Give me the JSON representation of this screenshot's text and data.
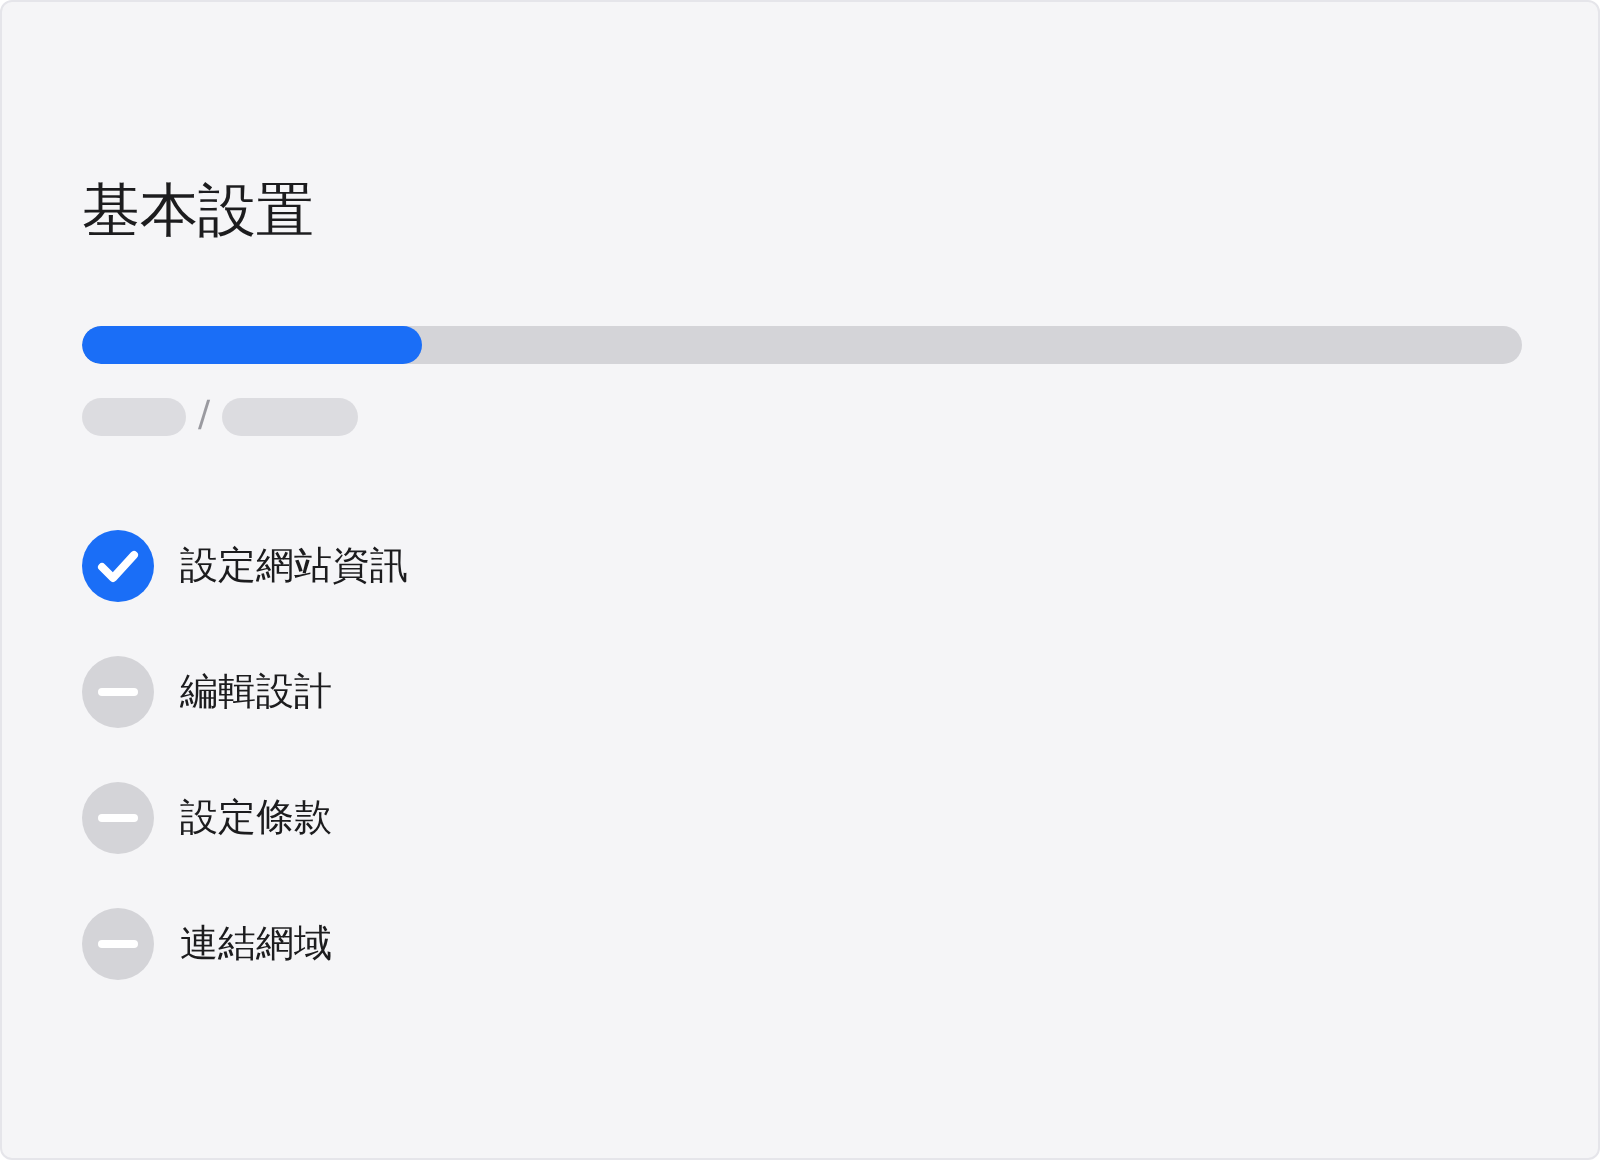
{
  "title": "基本設置",
  "progress": {
    "level": 0.236
  },
  "breadcrumb": {
    "separator": "/"
  },
  "steps": [
    {
      "label": "設定網站資訊",
      "done": true
    },
    {
      "label": "編輯設計",
      "done": false
    },
    {
      "label": "設定條款",
      "done": false
    },
    {
      "label": "連結網域",
      "done": false
    }
  ]
}
